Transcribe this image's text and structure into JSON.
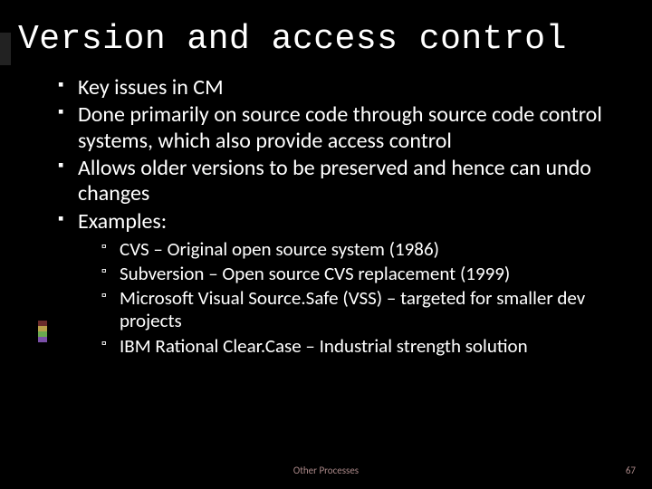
{
  "title": "Version and access control",
  "bullets": [
    "Key issues in CM",
    "Done primarily on source code through source code control systems, which also provide access control",
    "Allows older versions to be preserved and hence can undo changes",
    "Examples:"
  ],
  "sub_bullets": [
    "CVS – Original open source system (1986)",
    "Subversion – Open source CVS replacement (1999)",
    "Microsoft Visual Source.Safe (VSS) – targeted for smaller dev projects",
    "IBM Rational Clear.Case – Industrial strength solution"
  ],
  "footer_center": "Other Processes",
  "page_number": "67",
  "accent_colors": [
    "#6a2b2b",
    "#b9a04a",
    "#6aa84f",
    "#7a4fa8"
  ]
}
